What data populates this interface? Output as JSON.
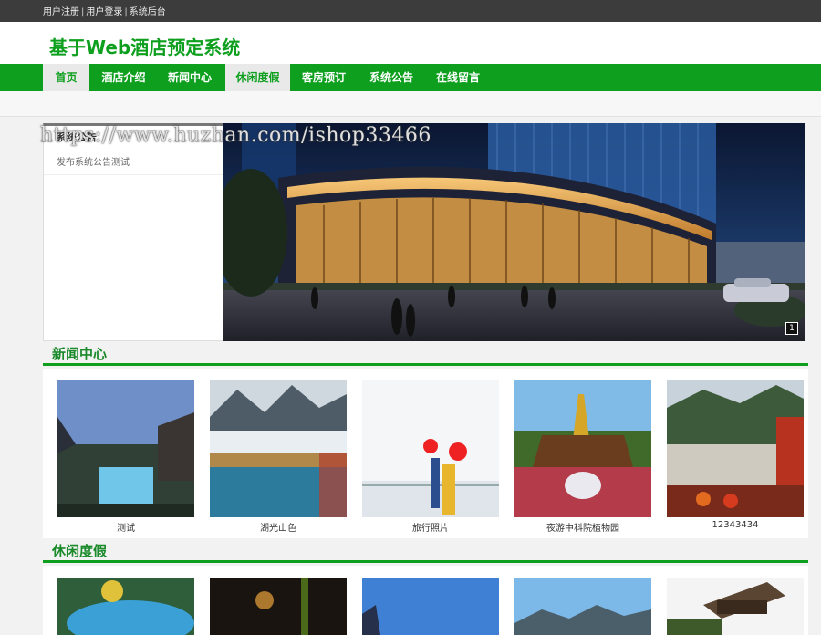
{
  "topbar": {
    "links": [
      {
        "label": "用户注册"
      },
      {
        "label": "用户登录"
      },
      {
        "label": "系统后台"
      }
    ],
    "separator": "|"
  },
  "header": {
    "title": "基于Web酒店预定系统"
  },
  "nav": {
    "items": [
      {
        "label": "首页",
        "active": true
      },
      {
        "label": "酒店介绍"
      },
      {
        "label": "新闻中心"
      },
      {
        "label": "休闲度假",
        "active": true
      },
      {
        "label": "客房预订"
      },
      {
        "label": "系统公告"
      },
      {
        "label": "在线留言"
      }
    ]
  },
  "notice": {
    "title": "系统公告",
    "items": [
      {
        "text": "发布系统公告测试"
      }
    ]
  },
  "banner": {
    "page_indicator": "1"
  },
  "watermark": "https://www.huzhan.com/ishop33466",
  "news": {
    "title": "新闻中心",
    "cards": [
      {
        "caption": "测试",
        "image": "resort-pool-photo"
      },
      {
        "caption": "湖光山色",
        "image": "misty-lake-mountain-photo"
      },
      {
        "caption": "旅行照片",
        "image": "couple-red-balloons-photo"
      },
      {
        "caption": "夜游中科院植物园",
        "image": "golden-temple-fountain-photo"
      },
      {
        "caption": "12343434",
        "image": "mountain-village-autumn-photo"
      }
    ]
  },
  "leisure": {
    "title": "休闲度假",
    "cards": [
      {
        "image": "water-park-photo"
      },
      {
        "image": "night-forest-photo"
      },
      {
        "image": "blue-sky-resort-photo"
      },
      {
        "image": "mountain-peaks-photo"
      },
      {
        "image": "chinese-gate-photo"
      }
    ]
  },
  "colors": {
    "brand_green": "#0e9f1f",
    "topbar": "#3c3c3c"
  }
}
